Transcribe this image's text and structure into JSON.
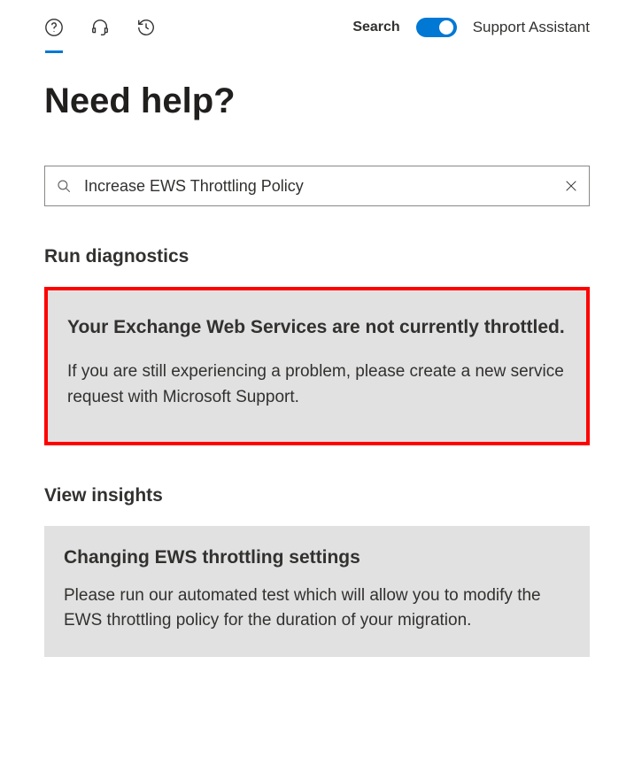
{
  "topbar": {
    "search_label": "Search",
    "assistant_label": "Support Assistant"
  },
  "page_title": "Need help?",
  "search": {
    "value": "Increase EWS Throttling Policy"
  },
  "diagnostics": {
    "heading": "Run diagnostics",
    "title": "Your Exchange Web Services are not currently throttled.",
    "body": "If you are still experiencing a problem, please create a new service request with Microsoft Support."
  },
  "insights": {
    "heading": "View insights",
    "title": "Changing EWS throttling settings",
    "body": "Please run our automated test which will allow you to modify the EWS throttling policy for the duration of your migration."
  }
}
